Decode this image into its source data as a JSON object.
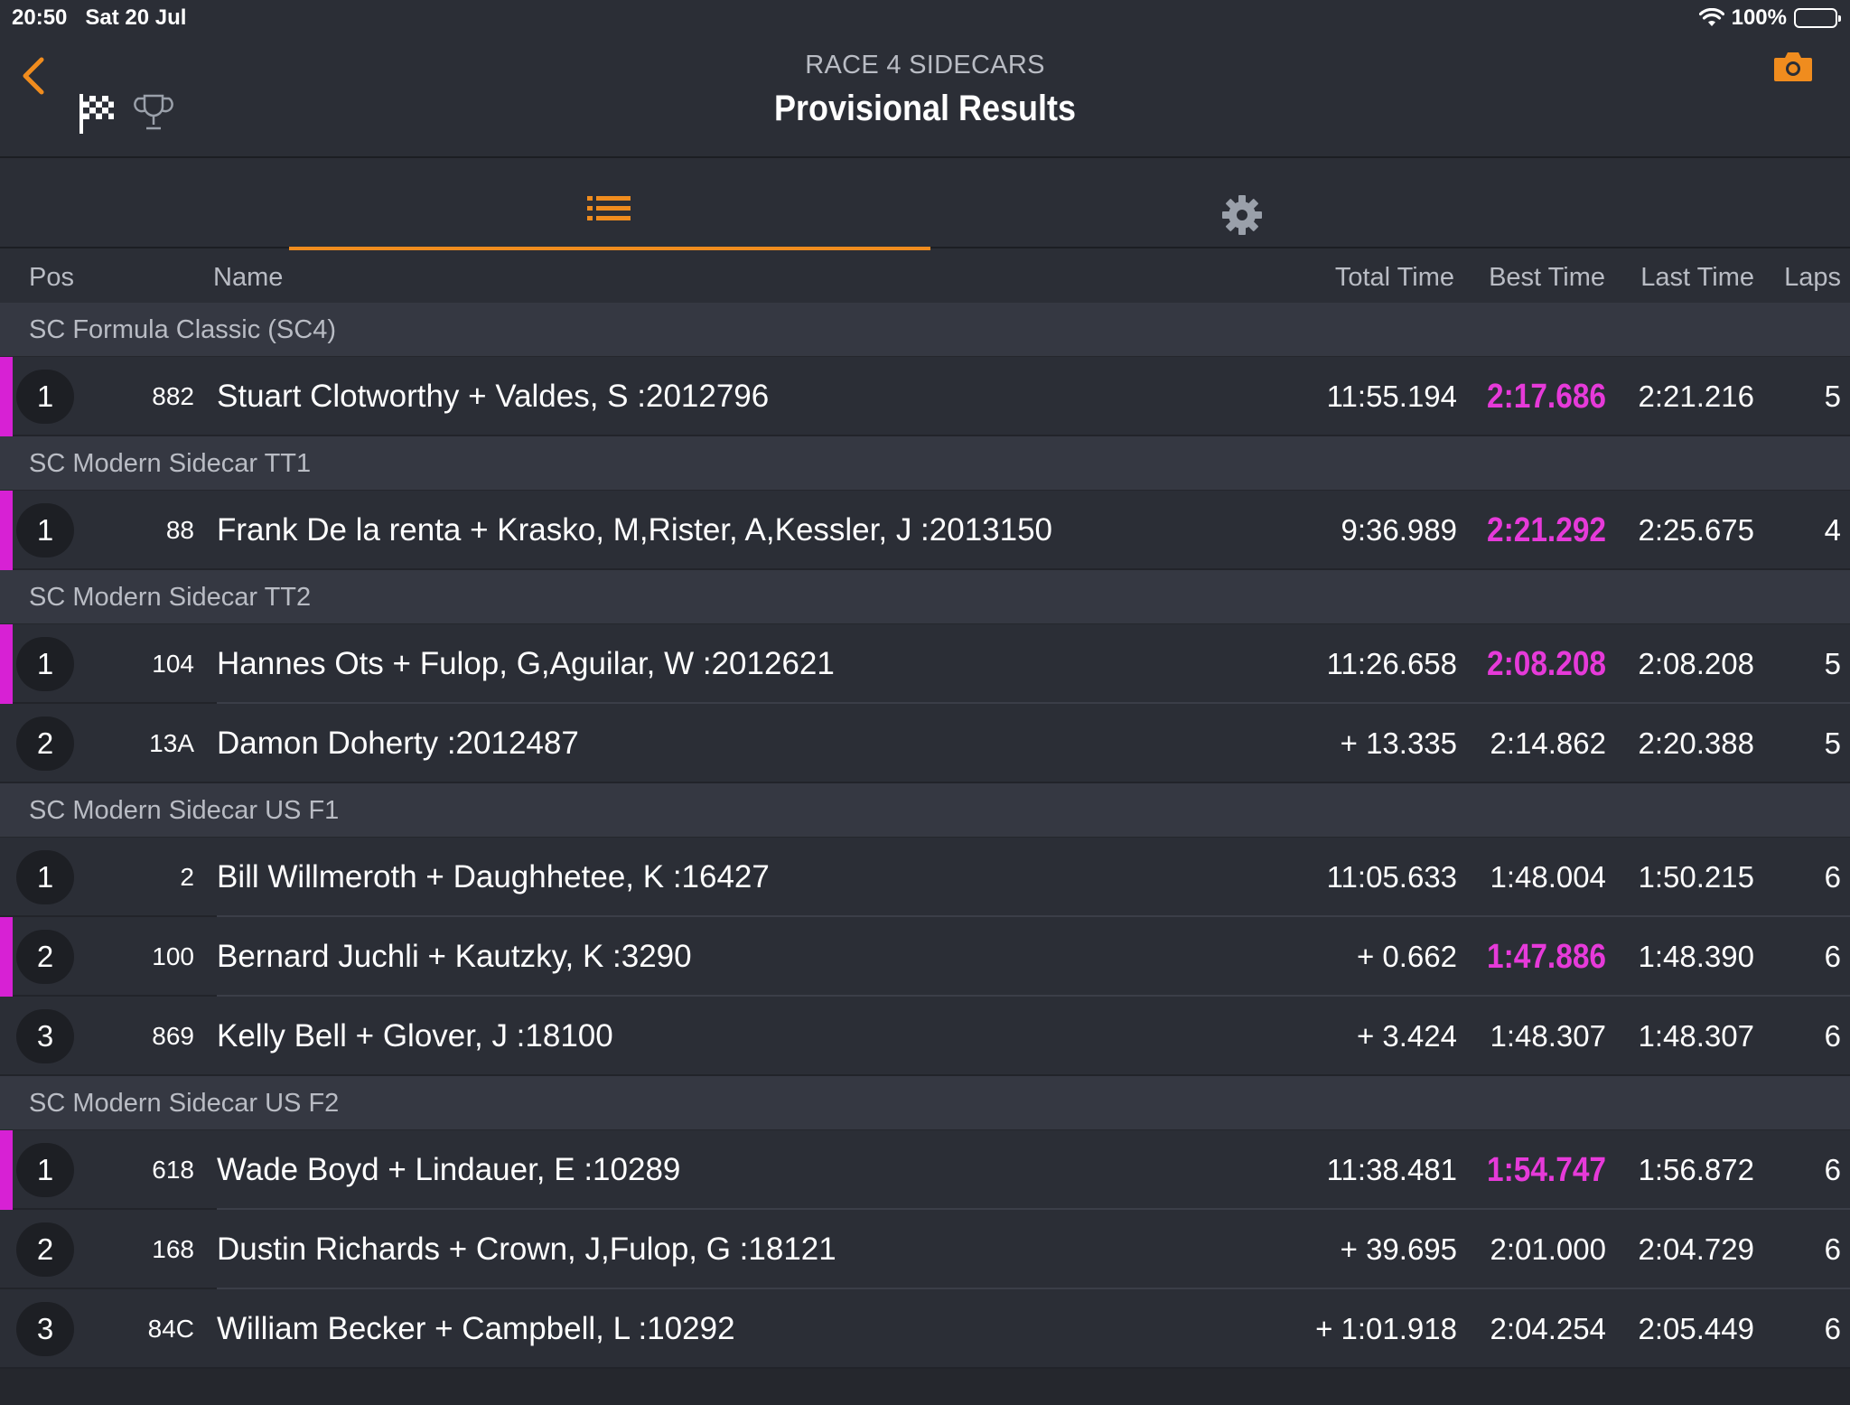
{
  "status": {
    "time": "20:50",
    "date": "Sat 20 Jul",
    "battery": "100%"
  },
  "nav": {
    "subtitle": "RACE 4 SIDECARS",
    "title": "Provisional Results"
  },
  "icons": {
    "back": "chevron-left-icon",
    "flag": "checkered-flag-icon",
    "trophy": "trophy-icon",
    "camera": "camera-icon",
    "list": "list-icon",
    "settings": "gear-icon"
  },
  "colors": {
    "accent": "#f08c1e",
    "fastest": "#e63ad9"
  },
  "columns": {
    "pos": "Pos",
    "name": "Name",
    "total": "Total Time",
    "best": "Best Time",
    "last": "Last Time",
    "laps": "Laps"
  },
  "groups": [
    {
      "title": "SC Formula Classic (SC4)",
      "rows": [
        {
          "pos": "1",
          "num": "882",
          "name": "Stuart Clotworthy + Valdes, S :2012796",
          "total": "11:55.194",
          "best": "2:17.686",
          "last": "2:21.216",
          "laps": "5",
          "fastest": true
        }
      ]
    },
    {
      "title": "SC Modern Sidecar TT1",
      "rows": [
        {
          "pos": "1",
          "num": "88",
          "name": "Frank De la renta + Krasko, M,Rister, A,Kessler, J :2013150",
          "total": "9:36.989",
          "best": "2:21.292",
          "last": "2:25.675",
          "laps": "4",
          "fastest": true
        }
      ]
    },
    {
      "title": "SC Modern Sidecar TT2",
      "rows": [
        {
          "pos": "1",
          "num": "104",
          "name": "Hannes Ots + Fulop, G,Aguilar, W :2012621",
          "total": "11:26.658",
          "best": "2:08.208",
          "last": "2:08.208",
          "laps": "5",
          "fastest": true
        },
        {
          "pos": "2",
          "num": "13A",
          "name": "Damon Doherty :2012487",
          "total": "+ 13.335",
          "best": "2:14.862",
          "last": "2:20.388",
          "laps": "5",
          "fastest": false
        }
      ]
    },
    {
      "title": "SC Modern Sidecar US F1",
      "rows": [
        {
          "pos": "1",
          "num": "2",
          "name": "Bill Willmeroth + Daughhetee, K :16427",
          "total": "11:05.633",
          "best": "1:48.004",
          "last": "1:50.215",
          "laps": "6",
          "fastest": false
        },
        {
          "pos": "2",
          "num": "100",
          "name": "Bernard Juchli + Kautzky, K :3290",
          "total": "+ 0.662",
          "best": "1:47.886",
          "last": "1:48.390",
          "laps": "6",
          "fastest": true
        },
        {
          "pos": "3",
          "num": "869",
          "name": "Kelly Bell + Glover, J :18100",
          "total": "+ 3.424",
          "best": "1:48.307",
          "last": "1:48.307",
          "laps": "6",
          "fastest": false
        }
      ]
    },
    {
      "title": "SC Modern Sidecar US F2",
      "rows": [
        {
          "pos": "1",
          "num": "618",
          "name": "Wade Boyd + Lindauer, E :10289",
          "total": "11:38.481",
          "best": "1:54.747",
          "last": "1:56.872",
          "laps": "6",
          "fastest": true
        },
        {
          "pos": "2",
          "num": "168",
          "name": "Dustin Richards + Crown, J,Fulop, G :18121",
          "total": "+ 39.695",
          "best": "2:01.000",
          "last": "2:04.729",
          "laps": "6",
          "fastest": false
        },
        {
          "pos": "3",
          "num": "84C",
          "name": "William Becker + Campbell, L :10292",
          "total": "+ 1:01.918",
          "best": "2:04.254",
          "last": "2:05.449",
          "laps": "6",
          "fastest": false
        }
      ]
    }
  ]
}
